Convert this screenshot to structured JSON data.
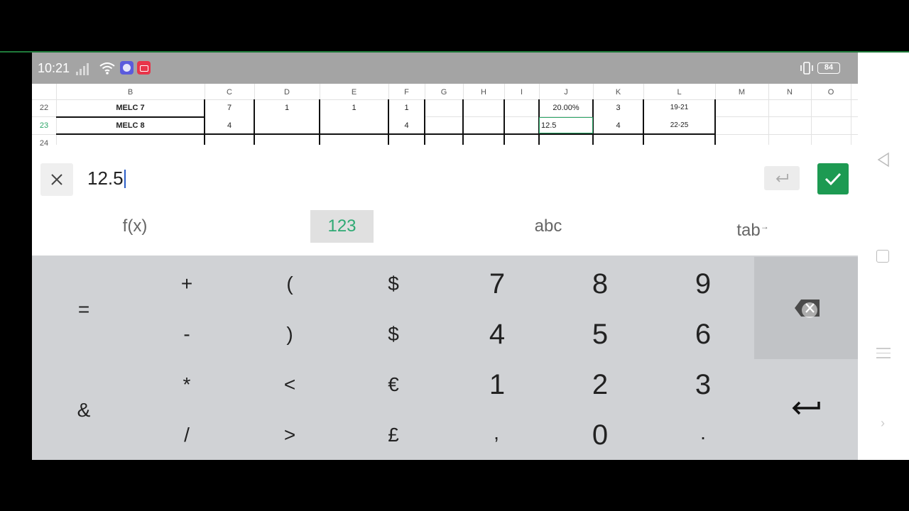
{
  "status": {
    "time": "10:21",
    "battery": "84"
  },
  "sheet": {
    "columns": [
      "B",
      "C",
      "D",
      "E",
      "F",
      "G",
      "H",
      "I",
      "J",
      "K",
      "L",
      "M",
      "N",
      "O"
    ],
    "rows": [
      {
        "num": "22",
        "B": "MELC 7",
        "C": "7",
        "D": "1",
        "E": "1",
        "F": "1",
        "J": "20.00%",
        "K": "3",
        "L": "19-21"
      },
      {
        "num": "23",
        "B": "MELC 8",
        "C": "4",
        "D": "",
        "E": "",
        "F": "4",
        "J": "12.5",
        "K": "4",
        "L": "22-25"
      },
      {
        "num": "24"
      }
    ]
  },
  "formula": {
    "value": "12.5"
  },
  "modes": {
    "fx": "f(x)",
    "num": "123",
    "abc": "abc",
    "tab": "tab"
  },
  "keys": {
    "eq": "=",
    "amp": "&",
    "plus": "+",
    "minus": "-",
    "star": "*",
    "slash": "/",
    "lparen": "(",
    "rparen": ")",
    "lt": "<",
    "gt": ">",
    "dollar1": "$",
    "dollar2": "$",
    "euro": "€",
    "pound": "£",
    "k7": "7",
    "k8": "8",
    "k9": "9",
    "k4": "4",
    "k5": "5",
    "k6": "6",
    "k1": "1",
    "k2": "2",
    "k3": "3",
    "comma": ",",
    "k0": "0",
    "dot": "."
  },
  "colors": {
    "accent": "#1d9a52",
    "active_mode": "#2faa74",
    "keyboard_bg": "#d0d2d5",
    "statusbar_bg": "#a4a4a4"
  }
}
